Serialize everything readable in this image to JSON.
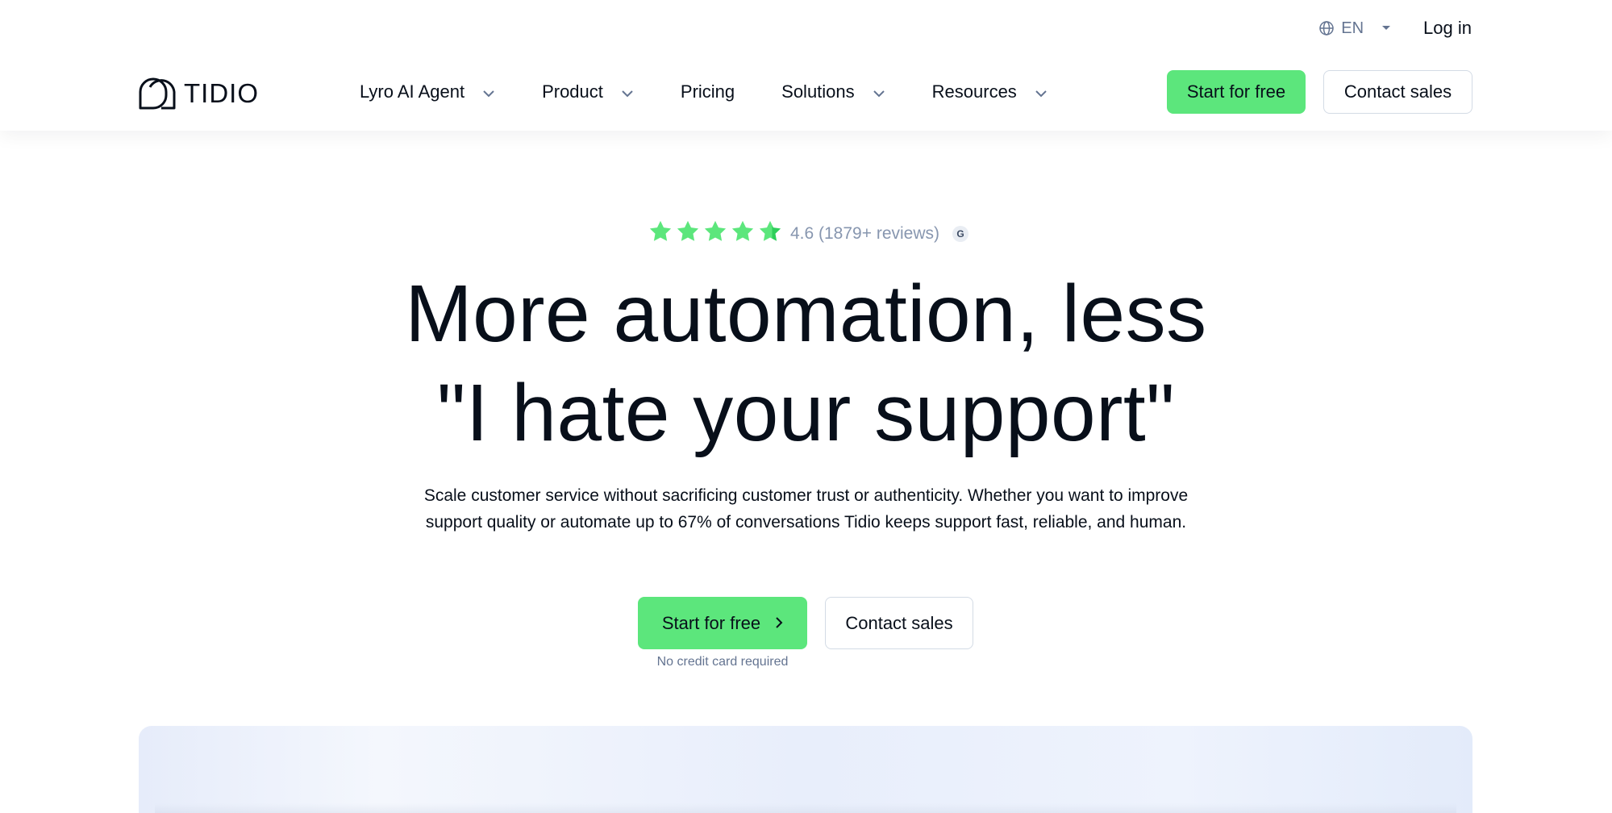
{
  "topbar": {
    "language": "EN",
    "login_label": "Log in"
  },
  "brand": {
    "logo_text": "TIDIO"
  },
  "nav": {
    "items": [
      {
        "label": "Lyro AI Agent",
        "has_dropdown": true
      },
      {
        "label": "Product",
        "has_dropdown": true
      },
      {
        "label": "Pricing",
        "has_dropdown": false
      },
      {
        "label": "Solutions",
        "has_dropdown": true
      },
      {
        "label": "Resources",
        "has_dropdown": true
      }
    ]
  },
  "header_cta": {
    "primary_label": "Start for free",
    "secondary_label": "Contact sales"
  },
  "rating": {
    "stars": 4.6,
    "text": "4.6 (1879+ reviews)",
    "badge_icon": "g2-icon"
  },
  "hero": {
    "headline_line1": "More automation, less",
    "headline_line2": "\"I hate your support\"",
    "subtext_line1": "Scale customer service without sacrificing customer trust or authenticity. Whether you want to improve",
    "subtext_line2": "support quality or automate up to 67% of conversations Tidio keeps support fast, reliable, and human.",
    "primary_cta": "Start for free",
    "secondary_cta": "Contact sales",
    "note": "No credit card required"
  },
  "colors": {
    "accent": "#5ce67c",
    "text": "#080f1a",
    "muted": "#647491",
    "border": "#d3dbe5"
  }
}
